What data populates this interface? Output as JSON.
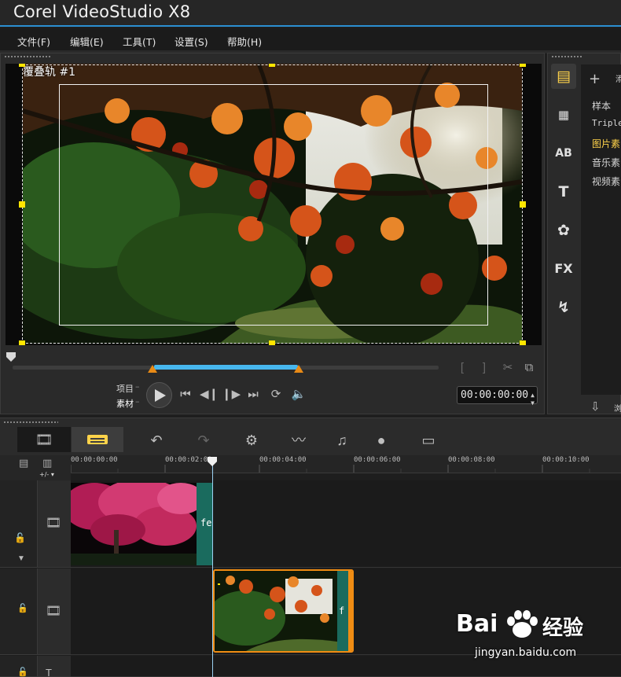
{
  "app": {
    "title": "Corel VideoStudio X8"
  },
  "menu": {
    "file": "文件(F)",
    "edit": "编辑(E)",
    "tools": "工具(T)",
    "settings": "设置(S)",
    "help": "帮助(H)"
  },
  "preview": {
    "overlay_label": "覆叠轨 #1",
    "mode_project": "项目",
    "mode_clip": "素材",
    "timecode": "00:00:00:00",
    "trim_in": "[",
    "trim_out": "]"
  },
  "library": {
    "add_label": "添",
    "items": [
      "样本",
      "Triple",
      "图片素",
      "音乐素",
      "视频素"
    ],
    "active_index": 2,
    "bottom_label": "浏",
    "colors": {
      "active": "#ffd34a",
      "normal": "#d6d6d6"
    }
  },
  "timeline": {
    "tracks_label": "+/- ▾",
    "ruler_ticks": [
      "00:00:00:00",
      "00:00:02:00",
      "00:00:04:00",
      "00:00:06:00",
      "00:00:08:00",
      "00:00:10:00"
    ],
    "clip1_tail": "fe",
    "clip2_tail": "f"
  },
  "watermark": {
    "brand": "Bai",
    "brand2": "经验",
    "url": "jingyan.baidu.com"
  }
}
